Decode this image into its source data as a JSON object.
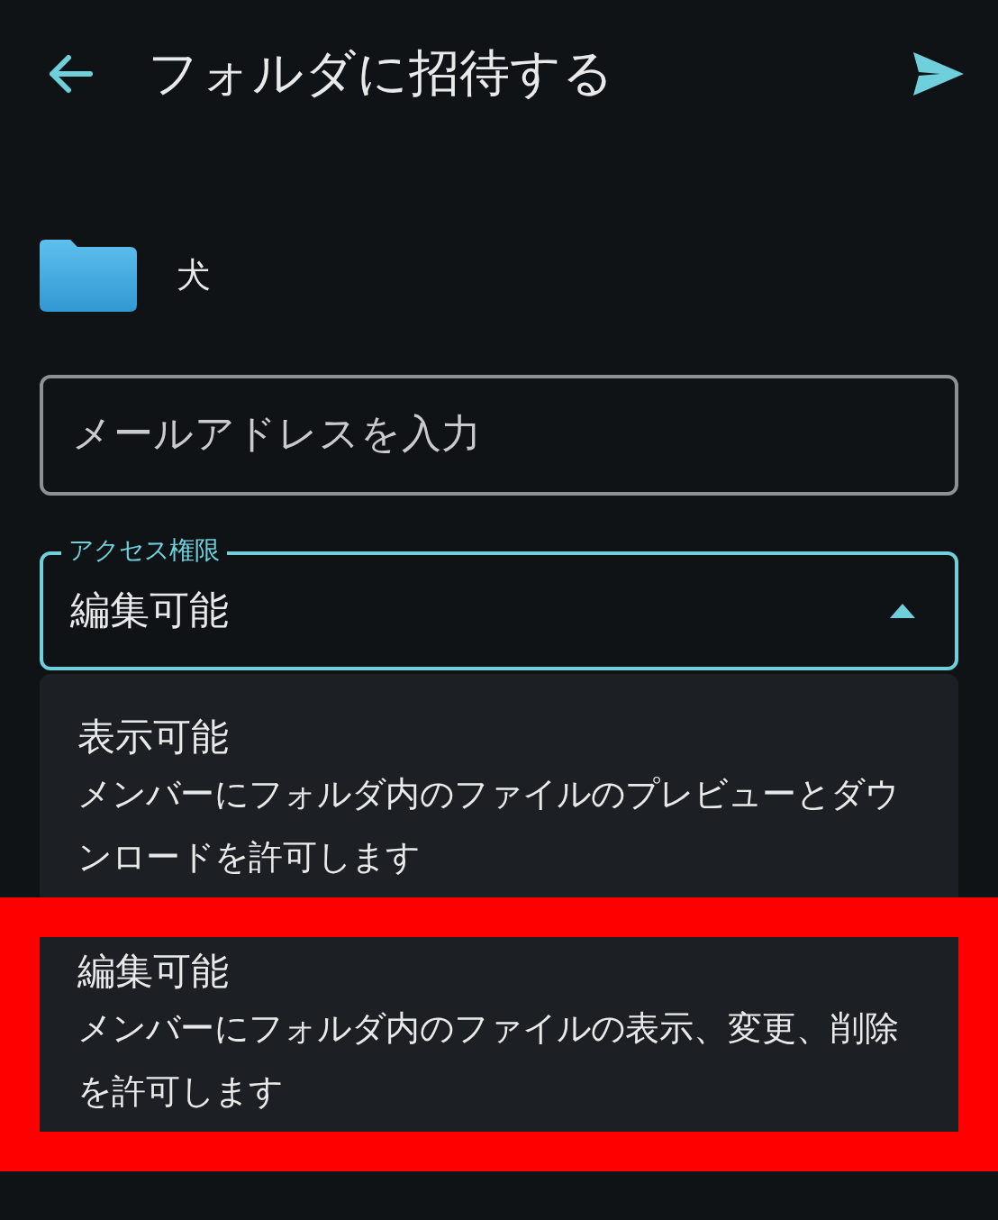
{
  "header": {
    "title": "フォルダに招待する"
  },
  "folder": {
    "name": "犬"
  },
  "email_field": {
    "placeholder": "メールアドレスを入力"
  },
  "access_select": {
    "label": "アクセス権限",
    "value": "編集可能",
    "expanded": true
  },
  "options": [
    {
      "title": "表示可能",
      "description": "メンバーにフォルダ内のファイルのプレビューとダウンロードを許可します",
      "highlighted": false
    },
    {
      "title": "編集可能",
      "description": "メンバーにフォルダ内のファイルの表示、変更、削除を許可します",
      "highlighted": true
    }
  ]
}
